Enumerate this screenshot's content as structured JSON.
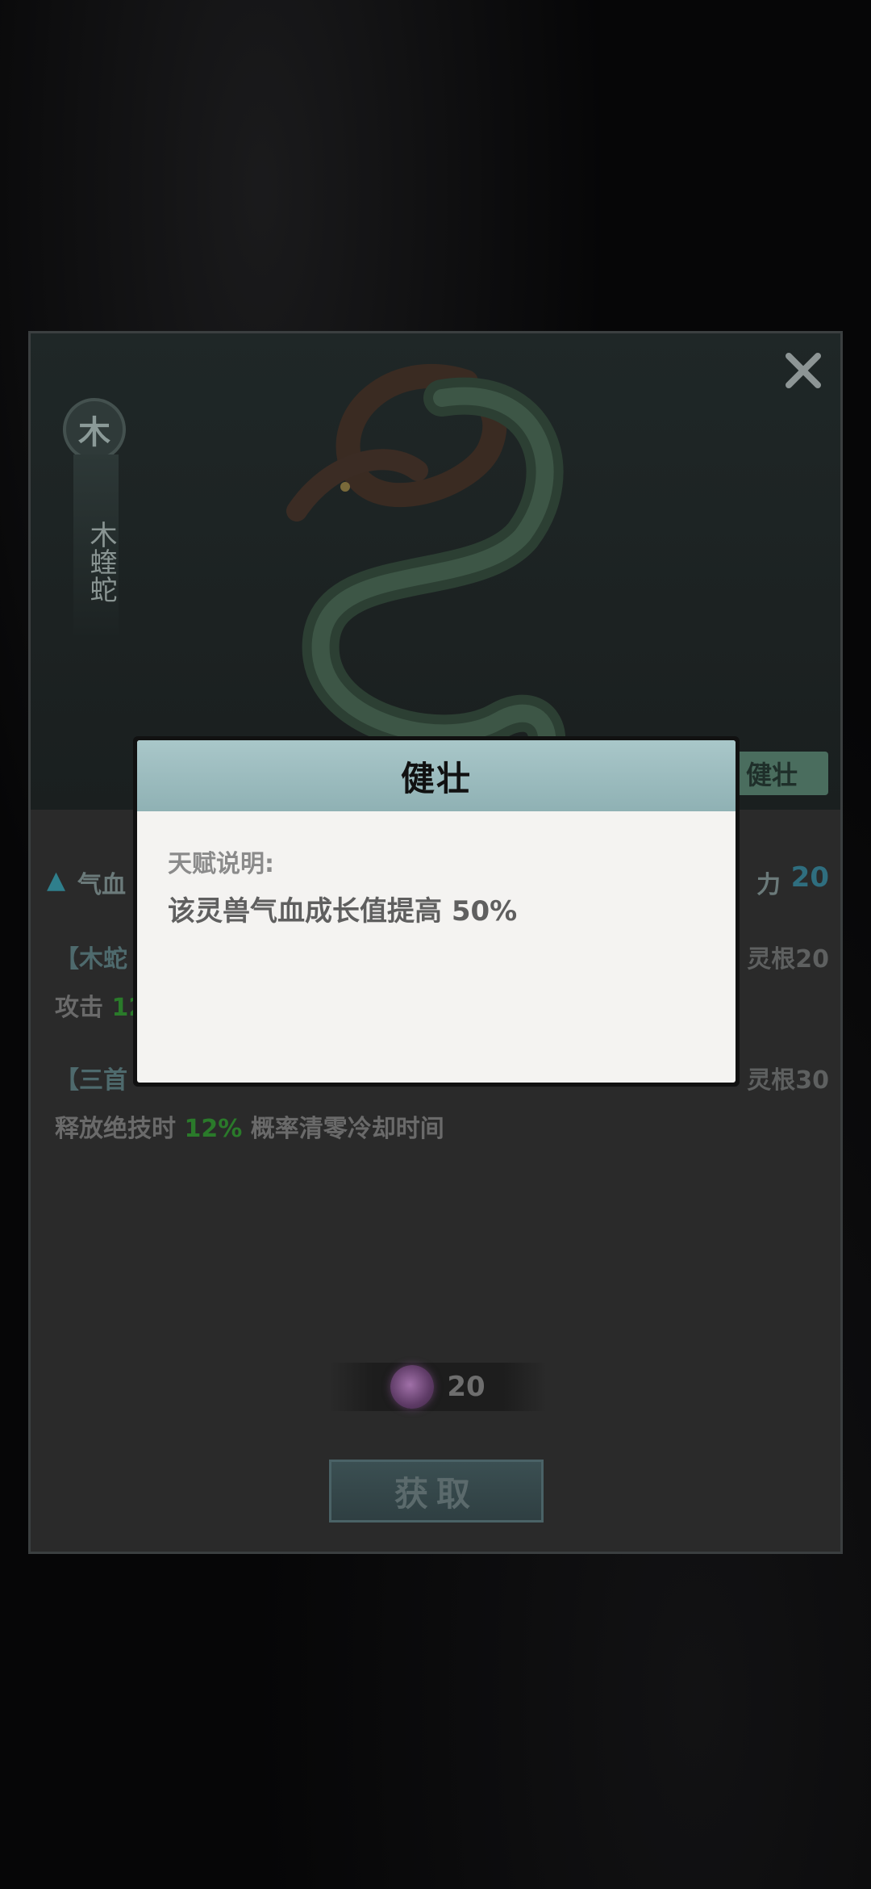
{
  "panel": {
    "element_badge": "木",
    "beast_name": "木蝰蛇",
    "talent_tag": "健壮",
    "stats": {
      "hp_label": "气血",
      "right_label": "力",
      "right_value": "20"
    },
    "skills": [
      {
        "name": "【木蛇",
        "requirement": "灵根20",
        "desc_prefix": "攻击 ",
        "desc_highlight": "12",
        "desc_suffix": ""
      },
      {
        "name": "【三首",
        "requirement": "灵根30",
        "desc_prefix": "释放绝技时 ",
        "desc_highlight": "12%",
        "desc_suffix": " 概率清零冷却时间"
      }
    ],
    "cost_value": "20",
    "acquire_label": "获取"
  },
  "popup": {
    "title": "健壮",
    "label": "天赋说明:",
    "description": "该灵兽气血成长值提高 50%"
  },
  "icons": {
    "close": "close-icon",
    "element": "wood-element-icon",
    "currency": "spirit-orb-icon"
  },
  "colors": {
    "accent": "#2f7f8c",
    "highlight_green": "#2a7a2a",
    "popup_header": "#9fbfc1"
  }
}
